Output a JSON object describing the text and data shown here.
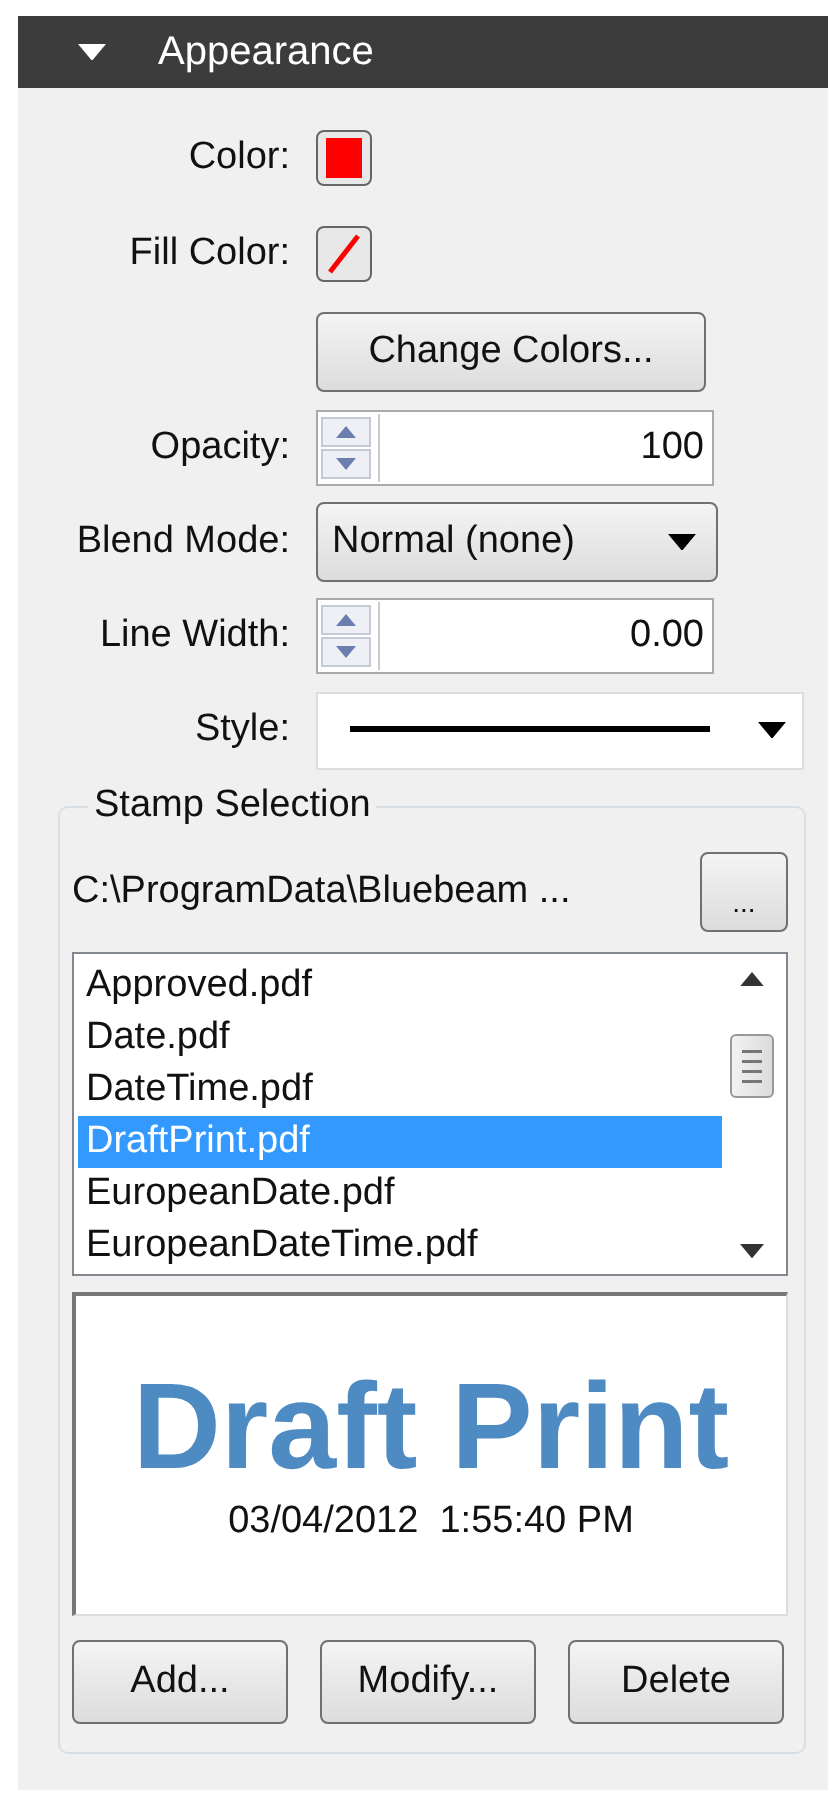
{
  "header": {
    "title": "Appearance",
    "expanded": true
  },
  "swatches": [
    {
      "label": "Color:",
      "kind": "solid",
      "color": "#ff0000"
    },
    {
      "label": "Fill Color:",
      "kind": "none",
      "color": "#ff0000"
    }
  ],
  "change_colors_button": "Change Colors...",
  "opacity": {
    "label": "Opacity:",
    "value": "100"
  },
  "blend_mode": {
    "label": "Blend Mode:",
    "value": "Normal (none)"
  },
  "line_width": {
    "label": "Line Width:",
    "value": "0.00"
  },
  "style": {
    "label": "Style:"
  },
  "stamp_selection": {
    "title": "Stamp Selection",
    "path": "C:\\ProgramData\\Bluebeam ...",
    "browse_button": "...",
    "items": [
      {
        "name": "Approved.pdf",
        "selected": false
      },
      {
        "name": "Date.pdf",
        "selected": false
      },
      {
        "name": "DateTime.pdf",
        "selected": false
      },
      {
        "name": "DraftPrint.pdf",
        "selected": true
      },
      {
        "name": "EuropeanDate.pdf",
        "selected": false
      },
      {
        "name": "EuropeanDateTime.pdf",
        "selected": false
      }
    ],
    "preview": {
      "title": "Draft Print",
      "date": "03/04/2012  1:55:40 PM"
    },
    "buttons": [
      "Add...",
      "Modify...",
      "Delete"
    ]
  }
}
